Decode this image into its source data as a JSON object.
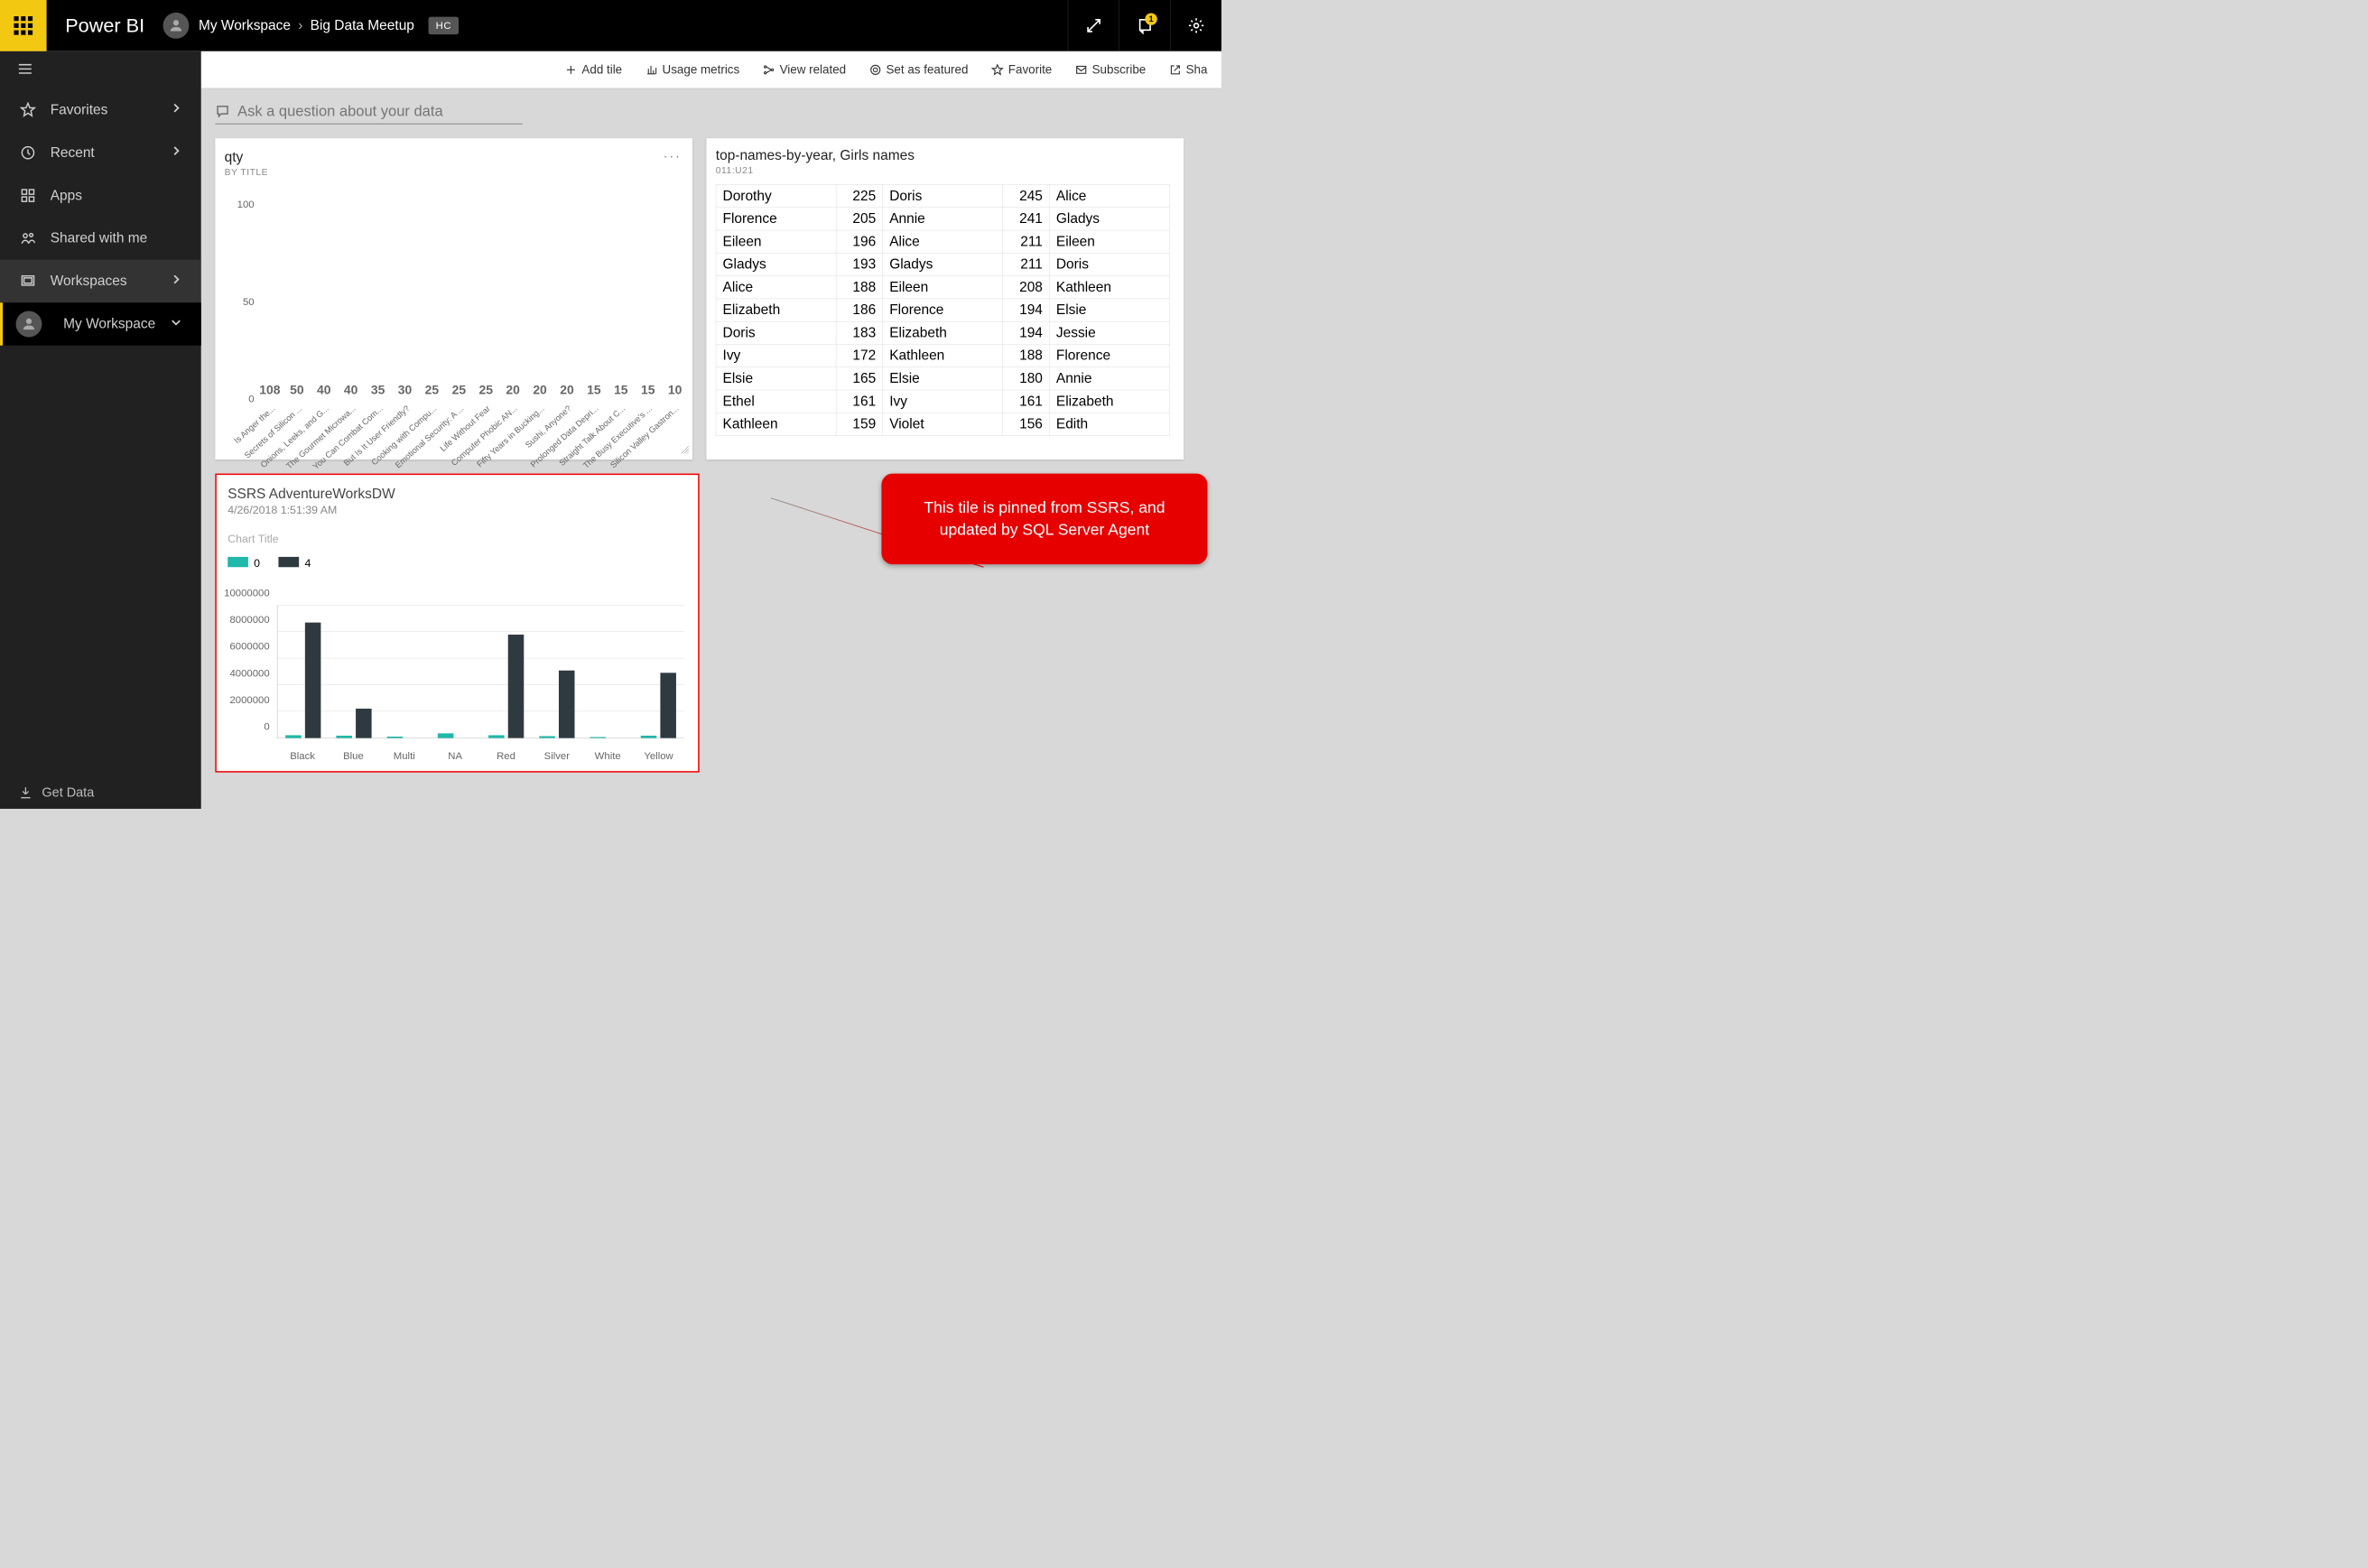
{
  "header": {
    "app_title": "Power BI",
    "breadcrumb": [
      "My Workspace",
      "Big Data Meetup"
    ],
    "badge": "HC",
    "notification_count": "1"
  },
  "sidebar": {
    "items": [
      "Favorites",
      "Recent",
      "Apps",
      "Shared with me",
      "Workspaces",
      "My Workspace"
    ],
    "get_data": "Get Data"
  },
  "toolbar": {
    "add_tile": "Add tile",
    "usage": "Usage metrics",
    "related": "View related",
    "featured": "Set as featured",
    "favorite": "Favorite",
    "subscribe": "Subscribe",
    "share": "Sha"
  },
  "qna_placeholder": "Ask a question about your data",
  "qty_tile": {
    "title": "qty",
    "subtitle": "BY TITLE"
  },
  "names_tile": {
    "title": "top-names-by-year, Girls names",
    "subtitle": "011:U21",
    "rows": [
      [
        "Dorothy",
        "225",
        "Doris",
        "245",
        "Alice"
      ],
      [
        "Florence",
        "205",
        "Annie",
        "241",
        "Gladys"
      ],
      [
        "Eileen",
        "196",
        "Alice",
        "211",
        "Eileen"
      ],
      [
        "Gladys",
        "193",
        "Gladys",
        "211",
        "Doris"
      ],
      [
        "Alice",
        "188",
        "Eileen",
        "208",
        "Kathleen"
      ],
      [
        "Elizabeth",
        "186",
        "Florence",
        "194",
        "Elsie"
      ],
      [
        "Doris",
        "183",
        "Elizabeth",
        "194",
        "Jessie"
      ],
      [
        "Ivy",
        "172",
        "Kathleen",
        "188",
        "Florence"
      ],
      [
        "Elsie",
        "165",
        "Elsie",
        "180",
        "Annie"
      ],
      [
        "Ethel",
        "161",
        "Ivy",
        "161",
        "Elizabeth"
      ],
      [
        "Kathleen",
        "159",
        "Violet",
        "156",
        "Edith"
      ]
    ]
  },
  "ssrs_tile": {
    "title": "SSRS AdventureWorksDW",
    "timestamp": "4/26/2018 1:51:39 AM",
    "chart_title": "Chart Title",
    "legend": [
      "0",
      "4"
    ]
  },
  "callout": {
    "line1": "This tile is pinned from SSRS, and",
    "line2": "updated by SQL Server Agent"
  },
  "chart_data": [
    {
      "id": "qty",
      "type": "bar",
      "title": "qty BY TITLE",
      "ylabel": "",
      "ylim": [
        0,
        110
      ],
      "yticks": [
        0,
        50,
        100
      ],
      "categories": [
        "Is Anger the...",
        "Secrets of Silicon ...",
        "Onions, Leeks, and G...",
        "The Gourmet Microwa...",
        "You Can Combat Com...",
        "But Is It User Friendly?",
        "Cooking with Compu...",
        "Emotional Security: A ...",
        "Life Without Fear",
        "Computer Phobic AN...",
        "Fifty Years in Bucking...",
        "Sushi, Anyone?",
        "Prolonged Data Depri...",
        "Straight Talk About C...",
        "The Busy Executive's ...",
        "Silicon Valley Gastron..."
      ],
      "values": [
        108,
        50,
        40,
        40,
        35,
        30,
        25,
        25,
        25,
        20,
        20,
        20,
        15,
        15,
        15,
        10
      ]
    },
    {
      "id": "ssrs",
      "type": "bar",
      "title": "Chart Title",
      "ylim": [
        0,
        10000000
      ],
      "yticks": [
        0,
        2000000,
        4000000,
        6000000,
        8000000,
        10000000
      ],
      "categories": [
        "Black",
        "Blue",
        "Multi",
        "NA",
        "Red",
        "Silver",
        "White",
        "Yellow"
      ],
      "series": [
        {
          "name": "0",
          "color": "#1fb8a9",
          "values": [
            200000,
            170000,
            100000,
            350000,
            200000,
            150000,
            60000,
            170000
          ]
        },
        {
          "name": "4",
          "color": "#2f3a40",
          "values": [
            8700000,
            2200000,
            0,
            0,
            7800000,
            5100000,
            0,
            4900000
          ]
        }
      ]
    }
  ]
}
